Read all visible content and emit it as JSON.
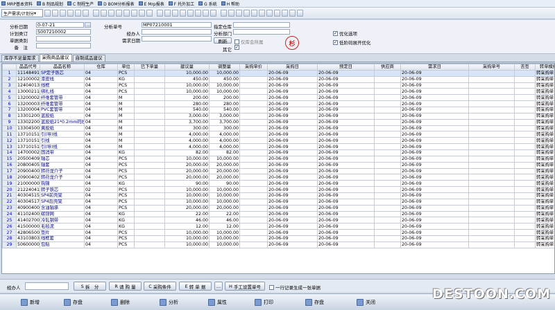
{
  "menu": [
    "MRP基本资料",
    "B 制品规划",
    "C 制程生产",
    "D BOM分析报表",
    "E Mrp报表",
    "F 托外加工",
    "G 系统",
    "H 帮助"
  ],
  "toolbar": {
    "combo_label": "生产需求/计划分"
  },
  "form": {
    "date_label": "分析日期",
    "date_value": "0-07-21",
    "date_btn": "...",
    "plan_label": "计划类订",
    "plan_value": "S007210002",
    "doctype_label": "单据类别",
    "remark_label": "备　注",
    "no_label": "分析单号",
    "no_value": "MP07210001",
    "handler_label": "经办人",
    "demand_date_label": "需求日期",
    "wh_label": "指定仓库",
    "dept_label": "分析部门",
    "refresh_label": "刷新",
    "stock_only_label": "仅库会所属",
    "other_label": "其它",
    "stamp_text": "杉",
    "opt1_label": "优化选项",
    "opt2_label": "低阶码展开优化"
  },
  "tabs": [
    "库存不足量需求",
    "采购商品建议",
    "自制成品建议"
  ],
  "grid": {
    "headers": [
      "",
      "品品代号",
      "品品名称",
      "仓库",
      "单位",
      "已下单量",
      "建议量",
      "调整量",
      "采购单价",
      "采购日",
      "预定日",
      "供应商",
      "需求日",
      "采购单号",
      "去签",
      "转单模组",
      "单位("
    ],
    "rows": [
      [
        "1",
        "11148491",
        "SP定子铁芯",
        "04",
        "PCS",
        "",
        "10,000.00",
        "10,000.00",
        "",
        "20-06-09",
        "20-06-09",
        "",
        "20-06-09",
        "",
        "",
        "转采购单",
        ""
      ],
      [
        "2",
        "12100002",
        "漆皮线",
        "04",
        "KG",
        "",
        "450.00",
        "450.00",
        "",
        "20-06-09",
        "20-06-09",
        "",
        "20-06-09",
        "",
        "",
        "转采购单",
        ""
      ],
      [
        "3",
        "12404013",
        "线框",
        "04",
        "PCS",
        "",
        "10,000.00",
        "10,000.00",
        "",
        "20-06-09",
        "20-06-09",
        "",
        "20-06-09",
        "",
        "",
        "转采购单",
        ""
      ],
      [
        "4",
        "13000211",
        "绑扎线",
        "04",
        "PCS",
        "",
        "10,000.00",
        "10,000.00",
        "",
        "20-06-09",
        "20-06-09",
        "",
        "20-06-09",
        "",
        "",
        "转采购单",
        ""
      ],
      [
        "5",
        "13200002",
        "纤维套管带",
        "04",
        "M",
        "",
        "200.00",
        "200.00",
        "",
        "20-06-09",
        "20-06-09",
        "",
        "20-06-09",
        "",
        "",
        "转采购单",
        ""
      ],
      [
        "6",
        "13200003",
        "纤维套管带",
        "04",
        "M",
        "",
        "280.00",
        "280.00",
        "",
        "20-06-09",
        "20-06-09",
        "",
        "20-06-09",
        "",
        "",
        "转采购单",
        ""
      ],
      [
        "7",
        "13200004",
        "PVC套管带",
        "04",
        "M",
        "",
        "540.00",
        "540.00",
        "",
        "20-06-09",
        "20-06-09",
        "",
        "20-06-09",
        "",
        "",
        "转采购单",
        ""
      ],
      [
        "8",
        "13301200",
        "蓝胶纸",
        "04",
        "M",
        "",
        "3,000.00",
        "3,000.00",
        "",
        "20-06-09",
        "20-06-09",
        "",
        "20-06-09",
        "",
        "",
        "转采购单",
        ""
      ],
      [
        "9",
        "13302200",
        "蓝胶纸21*0.2mm玛拉",
        "04",
        "M",
        "",
        "3,700.00",
        "3,700.00",
        "",
        "20-06-09",
        "20-06-09",
        "",
        "20-06-09",
        "",
        "",
        "转采购单",
        ""
      ],
      [
        "10",
        "13304500",
        "黄胶纸",
        "04",
        "M",
        "",
        "300.00",
        "300.00",
        "",
        "20-06-09",
        "20-06-09",
        "",
        "20-06-09",
        "",
        "",
        "转采购单",
        ""
      ],
      [
        "11",
        "13710151",
        "引(导)线",
        "04",
        "M",
        "",
        "4,000.00",
        "4,000.00",
        "",
        "20-06-09",
        "20-06-09",
        "",
        "20-06-09",
        "",
        "",
        "转采购单",
        ""
      ],
      [
        "12",
        "13710151",
        "引线",
        "04",
        "M",
        "",
        "4,000.00",
        "4,000.00",
        "",
        "20-06-09",
        "20-06-09",
        "",
        "20-06-09",
        "",
        "",
        "转采购单",
        ""
      ],
      [
        "13",
        "13710151",
        "引(导)线",
        "04",
        "M",
        "",
        "4,000.00",
        "4,000.00",
        "",
        "20-06-09",
        "20-06-09",
        "",
        "20-06-09",
        "",
        "",
        "转采购单",
        ""
      ],
      [
        "14",
        "14700002",
        "固消带",
        "04",
        "KG",
        "",
        "82.00",
        "82.00",
        "",
        "20-06-09",
        "20-06-09",
        "",
        "20-06-09",
        "",
        "",
        "转采购单",
        ""
      ],
      [
        "15",
        "20500409",
        "轴芯",
        "04",
        "PCS",
        "",
        "10,000.00",
        "10,000.00",
        "",
        "20-06-09",
        "20-06-09",
        "",
        "20-06-09",
        "",
        "",
        "转采购单",
        ""
      ],
      [
        "16",
        "20800405",
        "轴套",
        "04",
        "PCS",
        "",
        "20,000.00",
        "20,000.00",
        "",
        "20-06-09",
        "20-06-09",
        "",
        "20-06-09",
        "",
        "",
        "转采购单",
        ""
      ],
      [
        "17",
        "20900400",
        "转苻龙介子",
        "04",
        "PCS",
        "",
        "20,000.00",
        "20,000.00",
        "",
        "20-06-09",
        "20-06-09",
        "",
        "20-06-09",
        "",
        "",
        "转采购单",
        ""
      ],
      [
        "18",
        "20900402",
        "转苻龙介子",
        "04",
        "PCS",
        "",
        "20,000.00",
        "20,000.00",
        "",
        "20-06-09",
        "20-06-09",
        "",
        "20-06-09",
        "",
        "",
        "转采购单",
        ""
      ],
      [
        "19",
        "21000000",
        "钩锦",
        "04",
        "KG",
        "",
        "90.00",
        "90.00",
        "",
        "20-06-09",
        "20-06-09",
        "",
        "20-06-09",
        "",
        "",
        "转采购单",
        ""
      ],
      [
        "20",
        "21224041",
        "转子铁芯",
        "02",
        "PCS",
        "",
        "10,000.00",
        "10,000.00",
        "",
        "20-06-09",
        "20-06-09",
        "",
        "20-06-09",
        "",
        "",
        "转采购单",
        ""
      ],
      [
        "21",
        "40304515",
        "SP4前壳架",
        "04",
        "PCS",
        "",
        "10,000.00",
        "10,000.00",
        "",
        "20-06-09",
        "20-06-09",
        "",
        "20-06-09",
        "",
        "",
        "转采购单",
        ""
      ],
      [
        "22",
        "40304517",
        "SP4后壳架",
        "04",
        "PCS",
        "",
        "10,000.00",
        "10,000.00",
        "",
        "20-06-09",
        "20-06-09",
        "",
        "20-06-09",
        "",
        "",
        "转采购单",
        ""
      ],
      [
        "23",
        "40900400",
        "含油轴承",
        "04",
        "PCS",
        "",
        "20,000.00",
        "20,000.00",
        "",
        "20-06-09",
        "20-06-09",
        "",
        "20-06-09",
        "",
        "",
        "转采购单",
        ""
      ],
      [
        "24",
        "41102400",
        "碳锌网",
        "04",
        "KG",
        "",
        "22.00",
        "22.00",
        "",
        "20-06-09",
        "20-06-09",
        "",
        "20-06-09",
        "",
        "",
        "转采购单",
        ""
      ],
      [
        "25",
        "41402700",
        "冷轧钢带",
        "04",
        "KG",
        "",
        "46.00",
        "46.00",
        "",
        "20-06-09",
        "20-06-09",
        "",
        "20-06-09",
        "",
        "",
        "转采购单",
        ""
      ],
      [
        "26",
        "41500000",
        "毛毡泥",
        "04",
        "KG",
        "",
        "12.00",
        "12.00",
        "",
        "20-06-09",
        "20-06-09",
        "",
        "20-06-09",
        "",
        "",
        "转采购单",
        ""
      ],
      [
        "27",
        "42806500",
        "垫片",
        "04",
        "PCS",
        "",
        "10,000.00",
        "10,000.00",
        "",
        "20-06-09",
        "20-06-09",
        "",
        "20-06-09",
        "",
        "",
        "转采购单",
        ""
      ],
      [
        "28",
        "43103803",
        "线框套",
        "04",
        "PCS",
        "",
        "10,000.00",
        "10,000.00",
        "",
        "20-06-09",
        "20-06-09",
        "",
        "20-06-09",
        "",
        "",
        "转采购单",
        ""
      ],
      [
        "29",
        "50600000",
        "包贴",
        "04",
        "PCS",
        "",
        "10,000.00",
        "10,000.00",
        "",
        "20-06-09",
        "20-06-09",
        "",
        "20-06-09",
        "",
        "",
        "转采购单",
        ""
      ]
    ]
  },
  "actions": {
    "handler_label": "经办人",
    "split_label": "拆　分",
    "request_label": "请 购 量",
    "purchase_label": "采购条件",
    "convert_label": "转 单 据",
    "more_label": "...",
    "manual_label": "手工设置单号",
    "one_doc_label": "一行记录生成一张单据"
  },
  "footer": [
    "新增",
    "存盘",
    "删除",
    "分析",
    "属性",
    "打印",
    "存盘",
    "关闭"
  ],
  "watermark": "DESTOON.COM"
}
